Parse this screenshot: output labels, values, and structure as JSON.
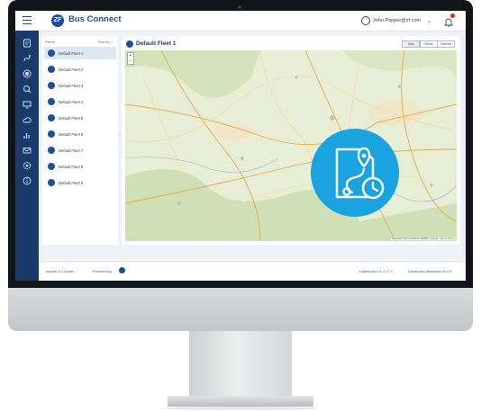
{
  "app": {
    "title": "Bus Connect",
    "logo_text": "ZF"
  },
  "header": {
    "user_email": "John.Pepper@zf.com"
  },
  "list": {
    "header_label": "Fleets",
    "sort_label": "Sort by",
    "items": [
      "Default Fleet 1",
      "Default Fleet 2",
      "Default Fleet 3",
      "Default Fleet 4",
      "Default Fleet 5",
      "Default Fleet 6",
      "Default Fleet 7",
      "Default Fleet 8",
      "Default Fleet 9"
    ],
    "active_index": 0
  },
  "map": {
    "title": "Default Fleet 1",
    "view_options": [
      "Map",
      "Offline",
      "Satellite"
    ],
    "active_view": "Map",
    "zoom_in": "+",
    "zoom_out": "−",
    "attribution": "Map data ©2021 GeoBasis-DE/BKG, Google · Terms of Use"
  },
  "footer": {
    "imprint": "Imprint & Contact",
    "powered": "Powered by",
    "dashboard": "Dashboard v1.4.17.1",
    "release": "Dashboard Backend v5.4.3"
  },
  "colors": {
    "brand_blue": "#1c4fa0",
    "nav_bg": "#1a3a6c",
    "hero_cyan": "#1aa3e1",
    "alert_red": "#e02b2b"
  },
  "icons": {
    "nav": [
      "dashboard-icon",
      "route-icon",
      "bus-icon",
      "search-map-icon",
      "tv-icon",
      "cloud-icon",
      "chart-icon",
      "messages-icon",
      "settings-icon",
      "info-icon"
    ],
    "hero": "route-schedule-icon"
  }
}
